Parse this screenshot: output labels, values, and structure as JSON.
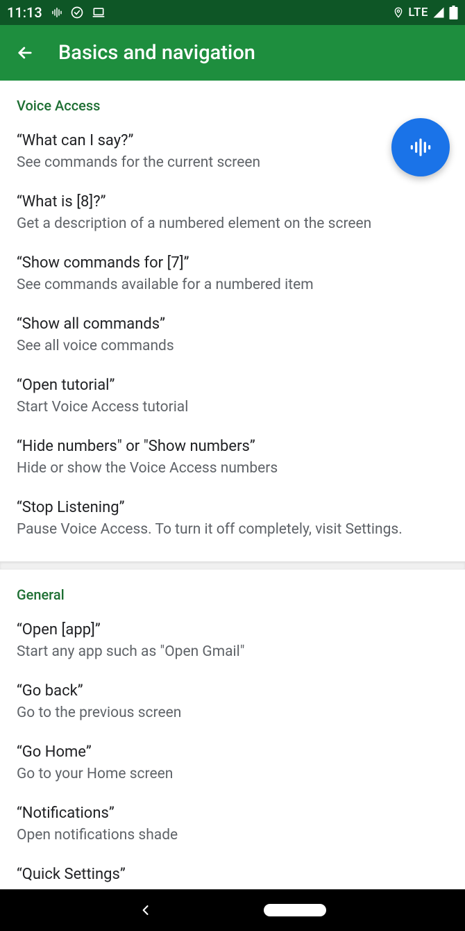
{
  "status": {
    "time": "11:13",
    "network_label": "LTE"
  },
  "appbar": {
    "title": "Basics and navigation"
  },
  "sections": [
    {
      "header": "Voice Access",
      "items": [
        {
          "title": "“What can I say?”",
          "sub": "See commands for the current screen"
        },
        {
          "title": "“What is [8]?”",
          "sub": "Get a description of a numbered element on the screen"
        },
        {
          "title": "“Show commands for [7]”",
          "sub": "See commands available for a numbered item"
        },
        {
          "title": "“Show all commands”",
          "sub": "See all voice commands"
        },
        {
          "title": "“Open tutorial”",
          "sub": "Start Voice Access tutorial"
        },
        {
          "title": "“Hide numbers\" or \"Show numbers”",
          "sub": "Hide or show the Voice Access numbers"
        },
        {
          "title": "“Stop Listening”",
          "sub": "Pause Voice Access. To turn it off completely, visit Settings."
        }
      ]
    },
    {
      "header": "General",
      "items": [
        {
          "title": "“Open [app]”",
          "sub": "Start any app such as \"Open Gmail\""
        },
        {
          "title": "“Go back”",
          "sub": "Go to the previous screen"
        },
        {
          "title": "“Go Home”",
          "sub": "Go to your Home screen"
        },
        {
          "title": "“Notifications”",
          "sub": "Open notifications shade"
        },
        {
          "title": "“Quick Settings”",
          "sub": ""
        }
      ]
    }
  ]
}
